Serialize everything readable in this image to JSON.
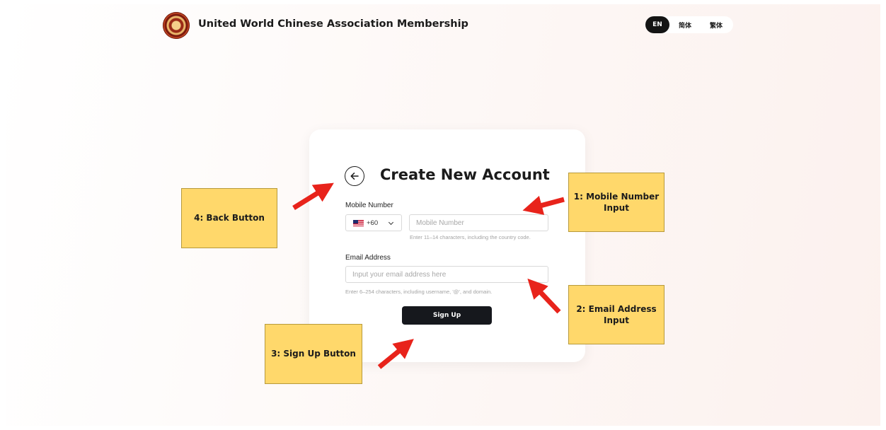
{
  "header": {
    "title": "United World Chinese Association Membership",
    "logo_icon": "association-emblem-icon",
    "languages": [
      {
        "label": "EN",
        "active": true
      },
      {
        "label": "简体",
        "active": false
      },
      {
        "label": "繁体",
        "active": false
      }
    ]
  },
  "form": {
    "title": "Create New Account",
    "back_icon": "arrow-left-icon",
    "mobile_label": "Mobile Number",
    "country_code": "+60",
    "country_flag_icon": "flag-icon",
    "mobile_placeholder": "Mobile Number",
    "mobile_hint": "Enter 11–14 characters, including the country code.",
    "email_label": "Email Address",
    "email_placeholder": "Input your email address here",
    "email_hint": "Enter 6–254 characters, including username, '@', and domain.",
    "signup_label": "Sign Up"
  },
  "annotations": {
    "mobile_note": "1: Mobile Number Input",
    "email_note": "2: Email Address Input",
    "signup_note": "3: Sign Up Button",
    "back_note": "4: Back Button",
    "note_color": "#ffd86b",
    "arrow_color": "#e8231b"
  },
  "colors": {
    "primary_dark": "#16181d",
    "card_background": "#ffffff"
  }
}
